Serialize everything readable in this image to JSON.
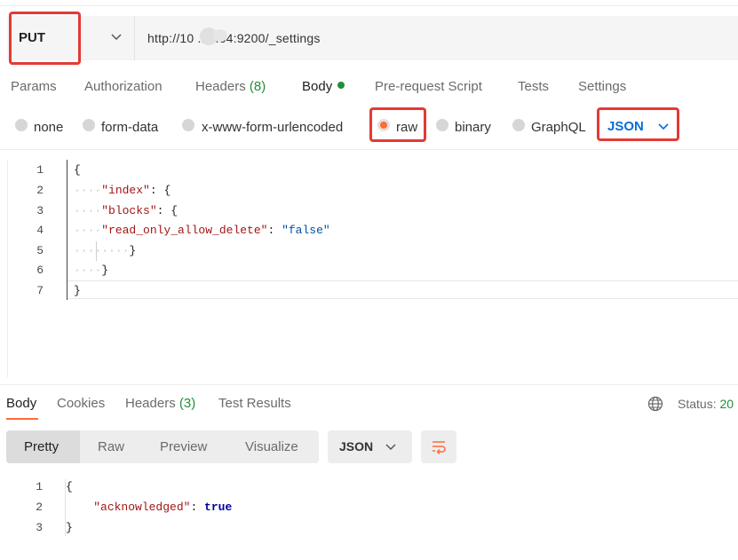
{
  "request": {
    "method": "PUT",
    "url": "http://10   .23.64:9200/_settings"
  },
  "request_tabs": [
    {
      "label": "Params"
    },
    {
      "label": "Authorization"
    },
    {
      "label": "Headers",
      "count": "(8)"
    },
    {
      "label": "Body"
    },
    {
      "label": "Pre-request Script"
    },
    {
      "label": "Tests"
    },
    {
      "label": "Settings"
    }
  ],
  "body_types": {
    "none": "none",
    "form_data": "form-data",
    "urlencoded": "x-www-form-urlencoded",
    "raw": "raw",
    "binary": "binary",
    "graphql": "GraphQL",
    "selected": "raw",
    "format": "JSON"
  },
  "request_body": {
    "line_numbers": [
      "1",
      "2",
      "3",
      "4",
      "5",
      "6",
      "7"
    ],
    "brace_open": "{",
    "brace_close": "}",
    "key_index": "\"index\"",
    "key_blocks": "\"blocks\"",
    "key_read_only": "\"read_only_allow_delete\"",
    "value_read_only": "\"false\""
  },
  "response_tabs": [
    {
      "label": "Body"
    },
    {
      "label": "Cookies"
    },
    {
      "label": "Headers",
      "count": "(3)"
    },
    {
      "label": "Test Results"
    }
  ],
  "status": {
    "label": "Status:",
    "value": "20"
  },
  "view_modes": [
    "Pretty",
    "Raw",
    "Preview",
    "Visualize"
  ],
  "response_format": "JSON",
  "response_body": {
    "line_numbers": [
      "1",
      "2",
      "3"
    ],
    "brace_open": "{",
    "brace_close": "}",
    "key": "\"acknowledged\"",
    "value": "true"
  },
  "colors": {
    "accent": "#ff6c37",
    "highlight_box": "#e53935",
    "json_blue": "#0b6dd6",
    "count_green": "#1e8f3a"
  },
  "icons": [
    "chevron-down-icon",
    "globe-icon",
    "wrap-lines-icon"
  ]
}
